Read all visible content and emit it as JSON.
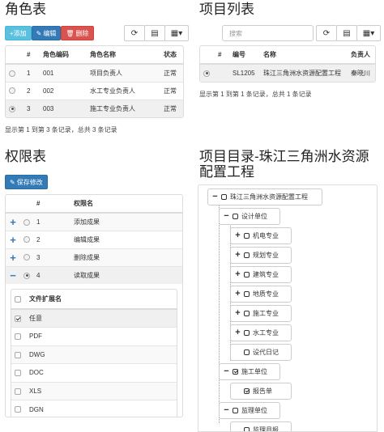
{
  "roles": {
    "title": "角色表",
    "add_label": "+添加",
    "edit_label": "编辑",
    "delete_label": "删除",
    "columns": [
      "#",
      "角色编码",
      "角色名称",
      "状态"
    ],
    "rows": [
      {
        "num": "1",
        "code": "001",
        "name": "项目负责人",
        "status": "正常",
        "selected": false
      },
      {
        "num": "2",
        "code": "002",
        "name": "水工专业负责人",
        "status": "正常",
        "selected": false
      },
      {
        "num": "3",
        "code": "003",
        "name": "施工专业负责人",
        "status": "正常",
        "selected": true
      }
    ],
    "summary": "显示第 1 到第 3 条记录，总共 3 条记录"
  },
  "projects": {
    "title": "项目列表",
    "search_placeholder": "搜索",
    "columns": [
      "#",
      "编号",
      "名称",
      "负责人"
    ],
    "rows": [
      {
        "code": "SL1205",
        "name": "珠江三角洲水资源配置工程",
        "owner": "秦晓川",
        "selected": true
      }
    ],
    "summary": "显示第 1 到第 1 条记录，总共 1 条记录"
  },
  "permissions": {
    "title": "权限表",
    "save_label": "保存修改",
    "columns": [
      "#",
      "权限名"
    ],
    "rows": [
      {
        "toggle": "+",
        "num": "1",
        "name": "添加成果",
        "selected": false
      },
      {
        "toggle": "+",
        "num": "2",
        "name": "编辑成果",
        "selected": false
      },
      {
        "toggle": "+",
        "num": "3",
        "name": "删除成果",
        "selected": false
      },
      {
        "toggle": "−",
        "num": "4",
        "name": "读取成果",
        "selected": true
      }
    ],
    "sub_header": "文件扩展名",
    "sub_rows": [
      {
        "name": "任意",
        "checked": true
      },
      {
        "name": "PDF",
        "checked": false
      },
      {
        "name": "DWG",
        "checked": false
      },
      {
        "name": "DOC",
        "checked": false
      },
      {
        "name": "XLS",
        "checked": false
      },
      {
        "name": "DGN",
        "checked": false
      }
    ]
  },
  "directory": {
    "title": "项目目录-珠江三角洲水资源配置工程",
    "nodes": [
      {
        "label": "珠江三角洲水资源配置工程",
        "toggle": "−",
        "checked": false
      },
      {
        "label": "设计单位",
        "toggle": "−",
        "checked": false
      },
      {
        "label": "机电专业",
        "toggle": "+",
        "checked": false
      },
      {
        "label": "规划专业",
        "toggle": "+",
        "checked": false
      },
      {
        "label": "建筑专业",
        "toggle": "+",
        "checked": false
      },
      {
        "label": "地质专业",
        "toggle": "+",
        "checked": false
      },
      {
        "label": "施工专业",
        "toggle": "+",
        "checked": false
      },
      {
        "label": "水工专业",
        "toggle": "+",
        "checked": false
      },
      {
        "label": "设代日记",
        "toggle": "",
        "checked": false
      },
      {
        "label": "施工单位",
        "toggle": "−",
        "checked": true
      },
      {
        "label": "报告单",
        "toggle": "",
        "checked": true
      },
      {
        "label": "监理单位",
        "toggle": "−",
        "checked": false
      },
      {
        "label": "监理月报",
        "toggle": "",
        "checked": false
      }
    ]
  }
}
